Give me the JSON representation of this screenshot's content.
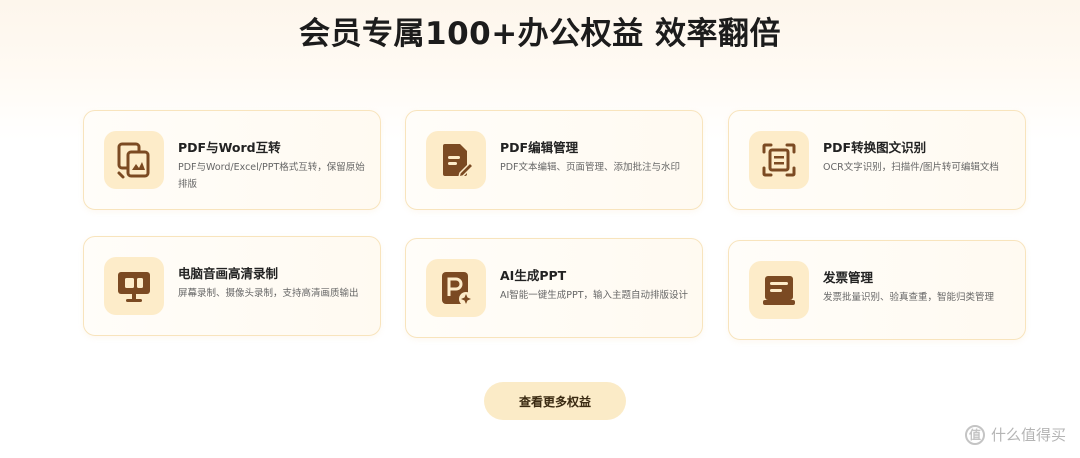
{
  "header": {
    "title": "会员专属100+办公权益 效率翻倍"
  },
  "cards": [
    {
      "icon": "pdf-word-convert-icon",
      "title": "PDF与Word互转",
      "desc": "PDF与Word/Excel/PPT格式互转，保留原始排版"
    },
    {
      "icon": "pdf-edit-icon",
      "title": "PDF编辑管理",
      "desc": "PDF文本编辑、页面管理、添加批注与水印"
    },
    {
      "icon": "ocr-scan-icon",
      "title": "PDF转换图文识别",
      "desc": "OCR文字识别，扫描件/图片转可编辑文档"
    },
    {
      "icon": "screen-record-icon",
      "title": "电脑音画高清录制",
      "desc": "屏幕录制、摄像头录制，支持高清画质输出"
    },
    {
      "icon": "ai-ppt-icon",
      "title": "AI生成PPT",
      "desc": "AI智能一键生成PPT，输入主题自动排版设计"
    },
    {
      "icon": "invoice-manage-icon",
      "title": "发票管理",
      "desc": "发票批量识别、验真查重，智能归类管理"
    }
  ],
  "more_button": {
    "label": "查看更多权益"
  },
  "watermark": {
    "text": "什么值得买",
    "glyph": "值"
  },
  "colors": {
    "accent_icon": "#7b4a22",
    "icon_bg": "#fdecc9",
    "card_border": "#f8e4bd",
    "button_bg": "#fbebc7"
  }
}
